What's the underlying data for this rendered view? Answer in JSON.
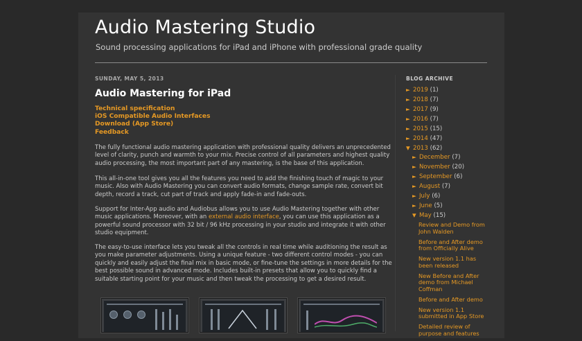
{
  "header": {
    "title": "Audio Mastering Studio",
    "description": "Sound processing applications for iPad and iPhone with professional grade quality"
  },
  "post": {
    "date": "SUNDAY, MAY 5, 2013",
    "title": "Audio Mastering for iPad",
    "links": [
      "Technical specification",
      "iOS Compatible Audio Interfaces",
      "Download (App Store)",
      "Feedback"
    ],
    "p1": [
      "The fully functional audio mastering application with professional quality delivers an unprecedented",
      "level of clarity, punch and warmth to your mix. Precise control of all parameters and highest quality",
      "audio processing, the most important part of any mastering, is the base of this application."
    ],
    "p2": [
      "This all-in-one tool gives you all the features you need to add the finishing touch of magic to your",
      "music. Also with Audio Mastering you can convert audio formats, change sample rate, convert bit",
      "depth, record a track, cut part of track and apply fade-in and fade-outs."
    ],
    "p3": {
      "line1": "Support for Inter-App audio and Audiobus allows you to use Audio Mastering together with other",
      "line2_before": "music applications. Moreover, with an ",
      "line2_link": "external audio interface",
      "line2_after": ", you can use this application as a",
      "line3": "powerful sound processor with 32 bit / 96 kHz processing in your studio and integrate it with other",
      "line4": "studio equipment."
    },
    "p4": [
      "The easy-to-use interface lets you tweak all the controls in real time while auditioning the result as",
      "you make parameter adjustments. Using a unique feature - two different control modes - you can",
      "quickly and easily adjust the final mix in basic mode, or fine-tune the settings in more details for the",
      "best possible sound in advanced mode. Includes built-in presets that allow you to quickly find a",
      "suitable starting point for your music and then tweak the processing to get a desired result."
    ]
  },
  "sidebar": {
    "title": "BLOG ARCHIVE",
    "years": [
      {
        "toggle": "►",
        "label": "2019",
        "count": "(1)"
      },
      {
        "toggle": "►",
        "label": "2018",
        "count": "(7)"
      },
      {
        "toggle": "►",
        "label": "2017",
        "count": "(9)"
      },
      {
        "toggle": "►",
        "label": "2016",
        "count": "(7)"
      },
      {
        "toggle": "►",
        "label": "2015",
        "count": "(15)"
      },
      {
        "toggle": "►",
        "label": "2014",
        "count": "(47)"
      },
      {
        "toggle": "▼",
        "label": "2013",
        "count": "(62)"
      }
    ],
    "months": [
      {
        "toggle": "►",
        "label": "December",
        "count": "(7)"
      },
      {
        "toggle": "►",
        "label": "November",
        "count": "(20)"
      },
      {
        "toggle": "►",
        "label": "September",
        "count": "(6)"
      },
      {
        "toggle": "►",
        "label": "August",
        "count": "(7)"
      },
      {
        "toggle": "►",
        "label": "July",
        "count": "(6)"
      },
      {
        "toggle": "►",
        "label": "June",
        "count": "(5)"
      },
      {
        "toggle": "▼",
        "label": "May",
        "count": "(15)"
      }
    ],
    "posts": [
      "Review and Demo from John Walden",
      "Before and After demo from Officially Alive",
      "New version 1.1 has been released",
      "New Before and After demo from Michael Coffman",
      "Before and After demo",
      "New version 1.1 submitted in App Store",
      "Detailed review of purpose and features"
    ]
  },
  "colors": {
    "background": "#292929",
    "content": "#333333",
    "accent": "#e69924",
    "text": "#cccccc",
    "title": "#ffffff"
  }
}
